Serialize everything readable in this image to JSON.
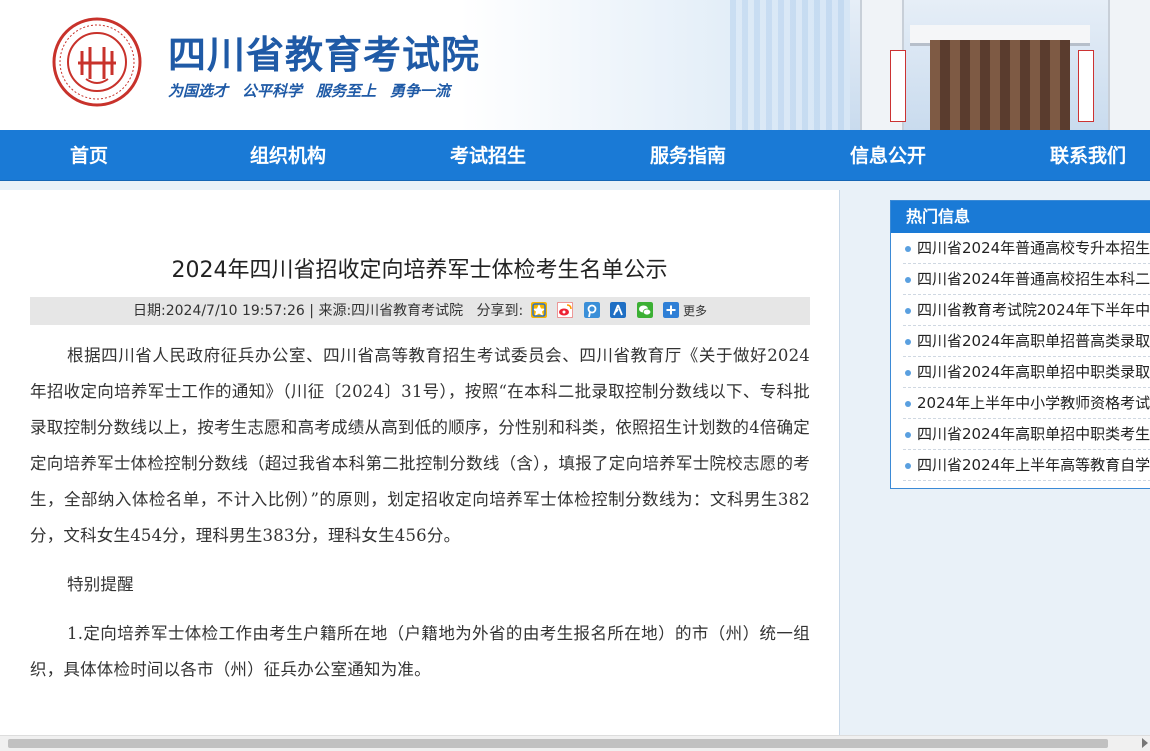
{
  "header": {
    "site_title": "四川省教育考试院",
    "slogans": [
      "为国选才",
      "公平科学",
      "服务至上",
      "勇争一流"
    ],
    "seal_text": "SICHUAN EDUCATIONAL EXAMINATION AUTHORITY 四川省教育考试院"
  },
  "nav": {
    "items": [
      "首页",
      "组织机构",
      "考试招生",
      "服务指南",
      "信息公开",
      "联系我们"
    ]
  },
  "article": {
    "title": "2024年四川省招收定向培养军士体检考生名单公示",
    "meta_date": "日期:2024/7/10 19:57:26",
    "meta_sep": " | ",
    "meta_source": "来源:四川省教育考试院",
    "share_label": "分享到:",
    "share_icons": [
      "qzone-icon",
      "weibo-icon",
      "tencent-weibo-icon",
      "renren-icon",
      "wechat-icon",
      "more-plus-icon"
    ],
    "share_more": "更多",
    "paragraphs": [
      "根据四川省人民政府征兵办公室、四川省高等教育招生考试委员会、四川省教育厅《关于做好2024年招收定向培养军士工作的通知》（川征〔2024〕31号），按照“在本科二批录取控制分数线以下、专科批录取控制分数线以上，按考生志愿和高考成绩从高到低的顺序，分性别和科类，依照招生计划数的4倍确定定向培养军士体检控制分数线（超过我省本科第二批控制分数线（含），填报了定向培养军士院校志愿的考生，全部纳入体检名单，不计入比例）”的原则，划定招收定向培养军士体检控制分数线为：文科男生382分，文科女生454分，理科男生383分，理科女生456分。",
      "特别提醒",
      "1.定向培养军士体检工作由考生户籍所在地（户籍地为外省的由考生报名所在地）的市（州）统一组织，具体体检时间以各市（州）征兵办公室通知为准。"
    ]
  },
  "sidebar": {
    "heading": "热门信息",
    "items": [
      "四川省2024年普通高校专升本招生",
      "四川省2024年普通高校招生本科二",
      "四川省教育考试院2024年下半年中",
      "四川省2024年高职单招普高类录取",
      "四川省2024年高职单招中职类录取",
      "2024年上半年中小学教师资格考试",
      "四川省2024年高职单招中职类考生",
      "四川省2024年上半年高等教育自学"
    ]
  },
  "colors": {
    "nav_blue": "#1a7ad6",
    "title_blue": "#1f5aa6",
    "seal_red": "#c8322b"
  }
}
